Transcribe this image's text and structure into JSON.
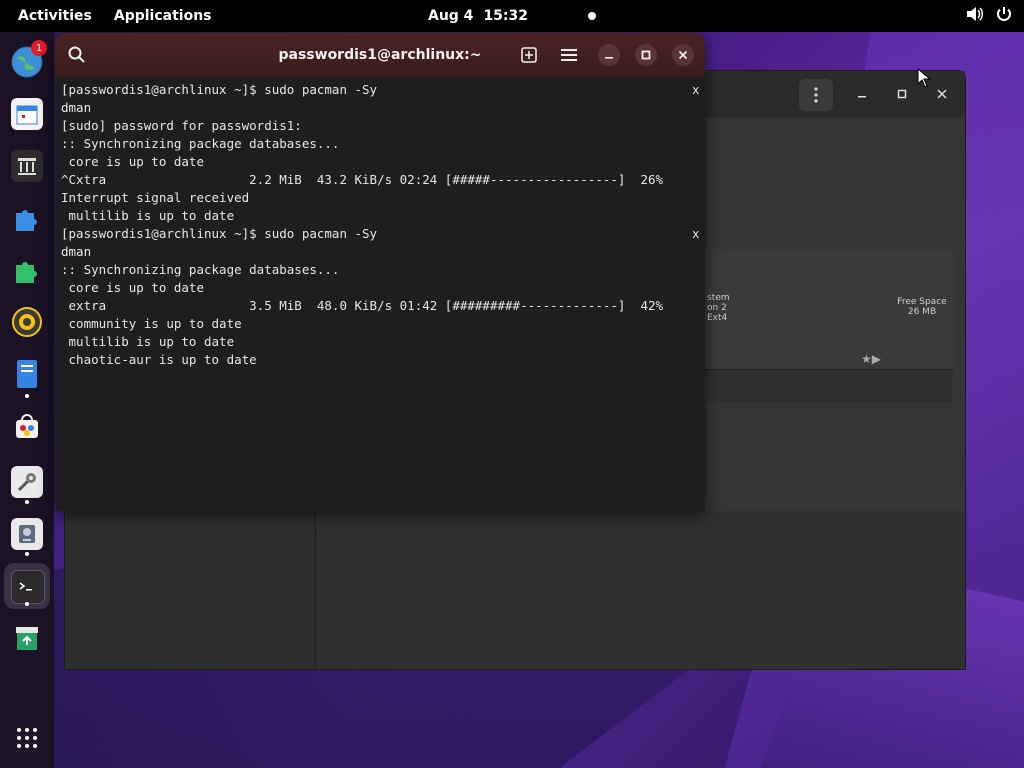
{
  "topbar": {
    "activities": "Activities",
    "applications": "Applications",
    "date": "Aug 4",
    "time": "15:32"
  },
  "dock": {
    "badge_count": "1"
  },
  "background_window": {
    "partition": {
      "line1": "stem",
      "line2": "on 2",
      "line3": "Ext4",
      "free_label": "Free Space",
      "free_size": "26 MB"
    }
  },
  "terminal": {
    "title": "passwordis1@archlinux:~",
    "lines": [
      "[passwordis1@archlinux ~]$ sudo pacman -Sy",
      "dman",
      "[sudo] password for passwordis1:",
      ":: Synchronizing package databases...",
      " core is up to date",
      "^Cxtra                   2.2 MiB  43.2 KiB/s 02:24 [#####-----------------]  26%",
      "Interrupt signal received",
      " multilib is up to date",
      "[passwordis1@archlinux ~]$ sudo pacman -Sy",
      "dman",
      ":: Synchronizing package databases...",
      " core is up to date",
      " extra                   3.5 MiB  48.0 KiB/s 01:42 [#########-------------]  42%",
      " community is up to date",
      " multilib is up to date",
      " chaotic-aur is up to date"
    ],
    "wrap_marks": [
      "x",
      "x"
    ]
  },
  "colors": {
    "terminal_header": "#3a1c1c",
    "terminal_bg": "#1e1e1e",
    "topbar": "#000000",
    "dock": "#1b1124"
  }
}
